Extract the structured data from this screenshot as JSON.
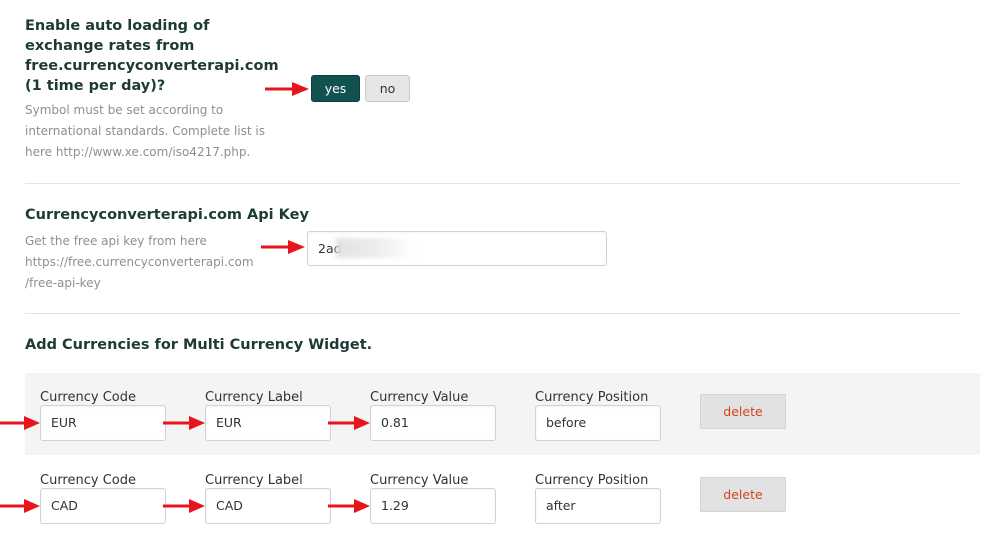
{
  "auto_loading": {
    "title": "Enable auto loading of exchange rates from free.currencyconverterapi.com (1 time per day)?",
    "description": "Symbol must be set according to international standards. Complete list is here http://www.xe.com/iso4217.php.",
    "yes_label": "yes",
    "no_label": "no",
    "selected": "yes"
  },
  "api_key": {
    "title": "Currencyconverterapi.com Api Key",
    "description": "Get the free api key from here https://free.currencyconverterapi.com /free-api-key",
    "value": "2ad"
  },
  "currencies": {
    "title": "Add Currencies for Multi Currency Widget.",
    "field_labels": {
      "code": "Currency Code",
      "label": "Currency Label",
      "value": "Currency Value",
      "position": "Currency Position"
    },
    "delete_label": "delete",
    "rows": [
      {
        "code": "EUR",
        "label": "EUR",
        "value": "0.81",
        "position": "before"
      },
      {
        "code": "CAD",
        "label": "CAD",
        "value": "1.29",
        "position": "after"
      }
    ]
  },
  "colors": {
    "accent": "#11524f",
    "arrow": "#e8141b",
    "delete_text": "#d4441c"
  }
}
